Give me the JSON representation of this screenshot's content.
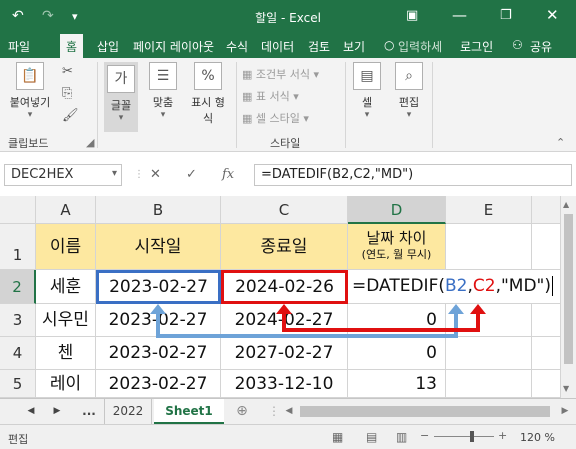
{
  "titlebar": {
    "title": "할일 - Excel",
    "undo_icon": "undo-icon",
    "redo_icon": "redo-icon",
    "customize_icon": "chevron-down-icon",
    "ribbon_display_icon": "ribbon-display-icon",
    "minimize_icon": "minimize-icon",
    "restore_icon": "restore-icon",
    "close_icon": "close-icon",
    "accent": "#217346"
  },
  "tabs": {
    "file": "파일",
    "home": "홈",
    "insert": "삽입",
    "layout": "페이지 레이아웃",
    "formulas": "수식",
    "data": "데이터",
    "review": "검토",
    "view": "보기",
    "tell_me": "입력하세",
    "login": "로그인",
    "share": "공유"
  },
  "ribbon": {
    "paste": "붙여넣기",
    "clipboard": "클립보드",
    "font": "글꼴",
    "align": "맞춤",
    "number_line1": "표시 형",
    "number_line2": "식",
    "cond_format": "조건부 서식",
    "table_format": "표 서식",
    "cell_style": "셀 스타일",
    "style": "스타일",
    "cells": "셀",
    "edit": "편집"
  },
  "formula_bar": {
    "name_box": "DEC2HEX",
    "cancel_icon": "✕",
    "enter_icon": "✓",
    "fx_icon": "fx",
    "formula": "=DATEDIF(B2,C2,\"MD\")"
  },
  "sheet": {
    "columns": [
      "A",
      "B",
      "C",
      "D",
      "E"
    ],
    "rows": [
      "1",
      "2",
      "3",
      "4",
      "5"
    ],
    "header": {
      "name": "이름",
      "start": "시작일",
      "end": "종료일",
      "diff_line1": "날짜 차이",
      "diff_line2": "(연도, 월 무시)"
    },
    "data": [
      {
        "name": "세훈",
        "start": "2023-02-27",
        "end": "2024-02-26",
        "diff": ""
      },
      {
        "name": "시우민",
        "start": "2023-02-27",
        "end": "2024-02-27",
        "diff": "0"
      },
      {
        "name": "첸",
        "start": "2023-02-27",
        "end": "2027-02-27",
        "diff": "0"
      },
      {
        "name": "레이",
        "start": "2023-02-27",
        "end": "2033-12-10",
        "diff": "13"
      }
    ],
    "edit_formula": {
      "prefix": "=DATEDIF(",
      "ref1": "B2",
      "comma1": ",",
      "ref2": "C2",
      "suffix": ",\"MD\")"
    },
    "ref1_color": "#3a6fc4",
    "ref2_color": "#e01010",
    "header_fill": "#fde8a0"
  },
  "sheet_tabs": {
    "ellipsis": "...",
    "tab1": "2022",
    "tab2": "Sheet1"
  },
  "status": {
    "mode": "편집",
    "zoom": "120 %"
  }
}
